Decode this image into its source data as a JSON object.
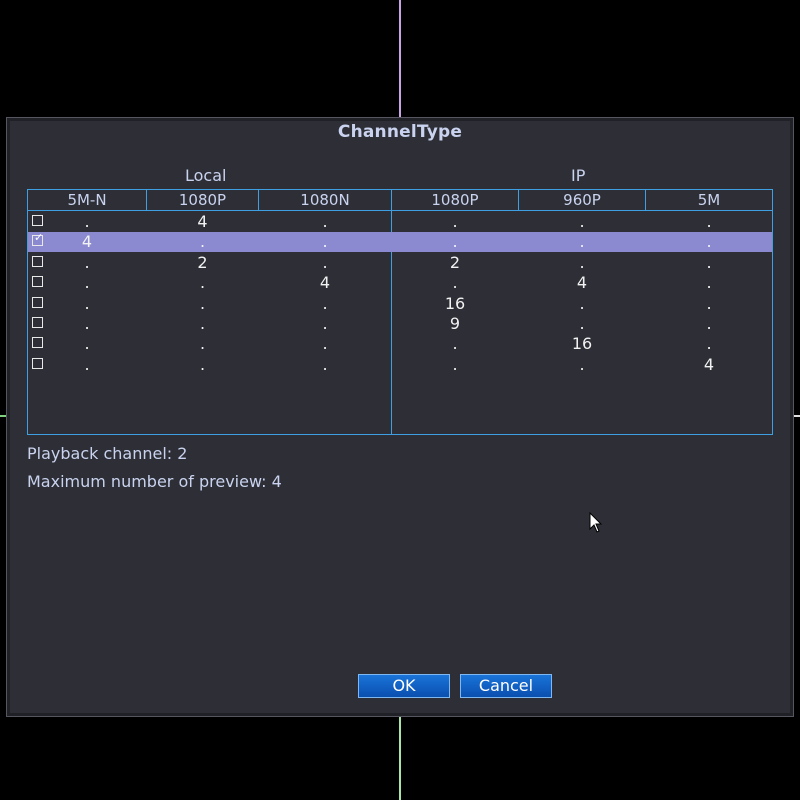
{
  "dialog": {
    "title": "ChannelType",
    "groups": {
      "local": "Local",
      "ip": "IP"
    },
    "columns": [
      "5M-N",
      "1080P",
      "1080N",
      "1080P",
      "960P",
      "5M"
    ],
    "rows": [
      {
        "checked": false,
        "selected": false,
        "values": [
          ".",
          "4",
          ".",
          ".",
          ".",
          "."
        ]
      },
      {
        "checked": true,
        "selected": true,
        "values": [
          "4",
          ".",
          ".",
          ".",
          ".",
          "."
        ]
      },
      {
        "checked": false,
        "selected": false,
        "values": [
          ".",
          "2",
          ".",
          "2",
          ".",
          "."
        ]
      },
      {
        "checked": false,
        "selected": false,
        "values": [
          ".",
          ".",
          "4",
          ".",
          "4",
          "."
        ]
      },
      {
        "checked": false,
        "selected": false,
        "values": [
          ".",
          ".",
          ".",
          "16",
          ".",
          "."
        ]
      },
      {
        "checked": false,
        "selected": false,
        "values": [
          ".",
          ".",
          ".",
          "9",
          ".",
          "."
        ]
      },
      {
        "checked": false,
        "selected": false,
        "values": [
          ".",
          ".",
          ".",
          ".",
          "16",
          "."
        ]
      },
      {
        "checked": false,
        "selected": false,
        "values": [
          ".",
          ".",
          ".",
          ".",
          ".",
          "4"
        ]
      }
    ],
    "info": {
      "playback": "Playback channel: 2",
      "max_preview": "Maximum number of preview: 4"
    },
    "buttons": {
      "ok": "OK",
      "cancel": "Cancel"
    },
    "colors": {
      "accent_border": "#3f9fe3",
      "selected_row": "#8b8ad0",
      "button": "#1a74d8"
    }
  }
}
